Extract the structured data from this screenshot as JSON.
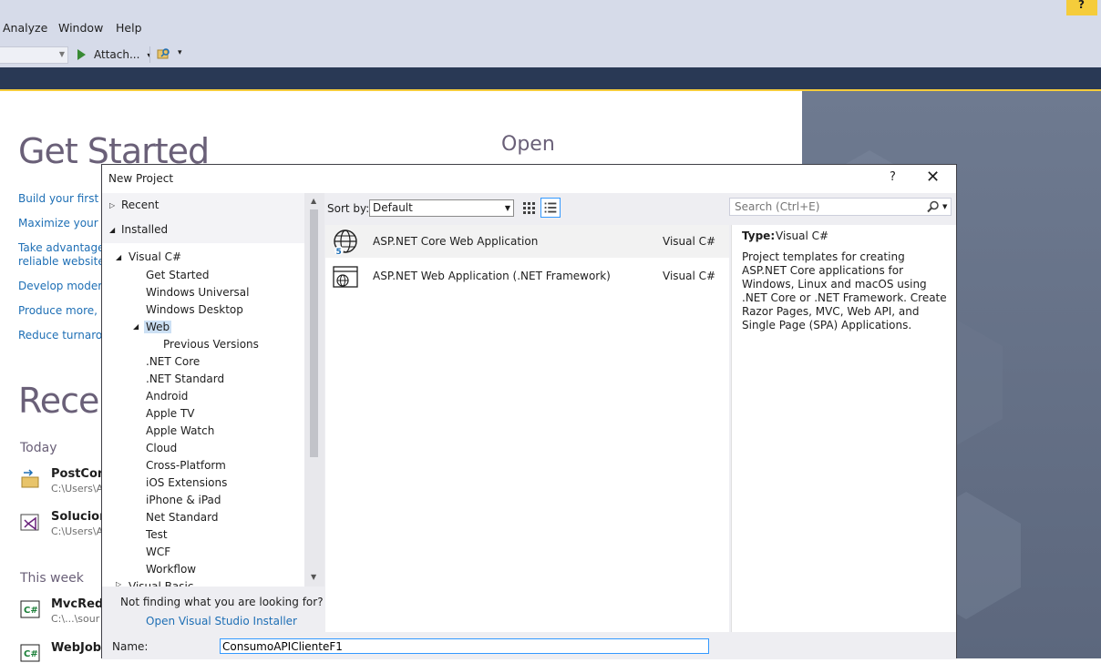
{
  "menu": {
    "items": [
      "Analyze",
      "Window",
      "Help"
    ]
  },
  "notification": {
    "icon": "notification-flag-icon",
    "glyph": "?"
  },
  "toolbar": {
    "attach_label": "Attach...",
    "dropdown_glyph": "▾"
  },
  "start_page": {
    "get_started_title": "Get Started",
    "open_title": "Open",
    "links": [
      "Build your first ap",
      "Maximize your pr",
      "Take advantage o",
      "reliable websites",
      "Develop modern,",
      "Produce more, fi",
      "Reduce turnarou"
    ],
    "recent_title": "Recen",
    "groups": {
      "today": "Today",
      "this_week": "This week"
    },
    "recent_items": [
      {
        "name": "PostCons",
        "path": "C:\\Users\\A",
        "icon": "project-file-icon"
      },
      {
        "name": "Solucion",
        "path": "C:\\Users\\A",
        "icon": "vs-solution-icon"
      },
      {
        "name": "MvcRedis",
        "path": "C:\\...\\sour",
        "icon": "csharp-project-icon"
      },
      {
        "name": "WebJobM",
        "path": "",
        "icon": "csharp-project-icon"
      }
    ]
  },
  "dialog": {
    "title": "New Project",
    "help": "?",
    "close": "✕",
    "left_pane": {
      "recent": "Recent",
      "installed": "Installed",
      "visual_csharp": "Visual C#",
      "items": [
        "Get Started",
        "Windows Universal",
        "Windows Desktop",
        "Web",
        "Previous Versions",
        ".NET Core",
        ".NET Standard",
        "Android",
        "Apple TV",
        "Apple Watch",
        "Cloud",
        "Cross-Platform",
        "iOS Extensions",
        "iPhone & iPad",
        "Net Standard",
        "Test",
        "WCF",
        "Workflow"
      ],
      "visual_basic": "Visual Basic",
      "selected": "Web"
    },
    "not_finding": {
      "text": "Not finding what you are looking for?",
      "link": "Open Visual Studio Installer"
    },
    "sort": {
      "label": "Sort by:",
      "value": "Default"
    },
    "search": {
      "placeholder": "Search (Ctrl+E)"
    },
    "templates": [
      {
        "name": "ASP.NET Core Web Application",
        "lang": "Visual C#",
        "icon": "aspnet-core-globe-icon",
        "selected": true
      },
      {
        "name": "ASP.NET Web Application (.NET Framework)",
        "lang": "Visual C#",
        "icon": "aspnet-web-app-icon",
        "selected": false
      }
    ],
    "description": {
      "type_label": "Type:",
      "type_value": "Visual C#",
      "text": "Project templates for creating ASP.NET Core applications for Windows, Linux and macOS using .NET Core or .NET Framework. Create Razor Pages, MVC, Web API, and Single Page (SPA) Applications."
    },
    "name_field": {
      "label": "Name:",
      "value": "ConsumoAPIClienteF1"
    }
  },
  "colors": {
    "chrome": "#d6dbe9",
    "title_bar": "#293955",
    "accent_yellow": "#f5cc3b",
    "link": "#1e6fb5",
    "heading": "#6a6078",
    "selection": "#cce0f4"
  }
}
